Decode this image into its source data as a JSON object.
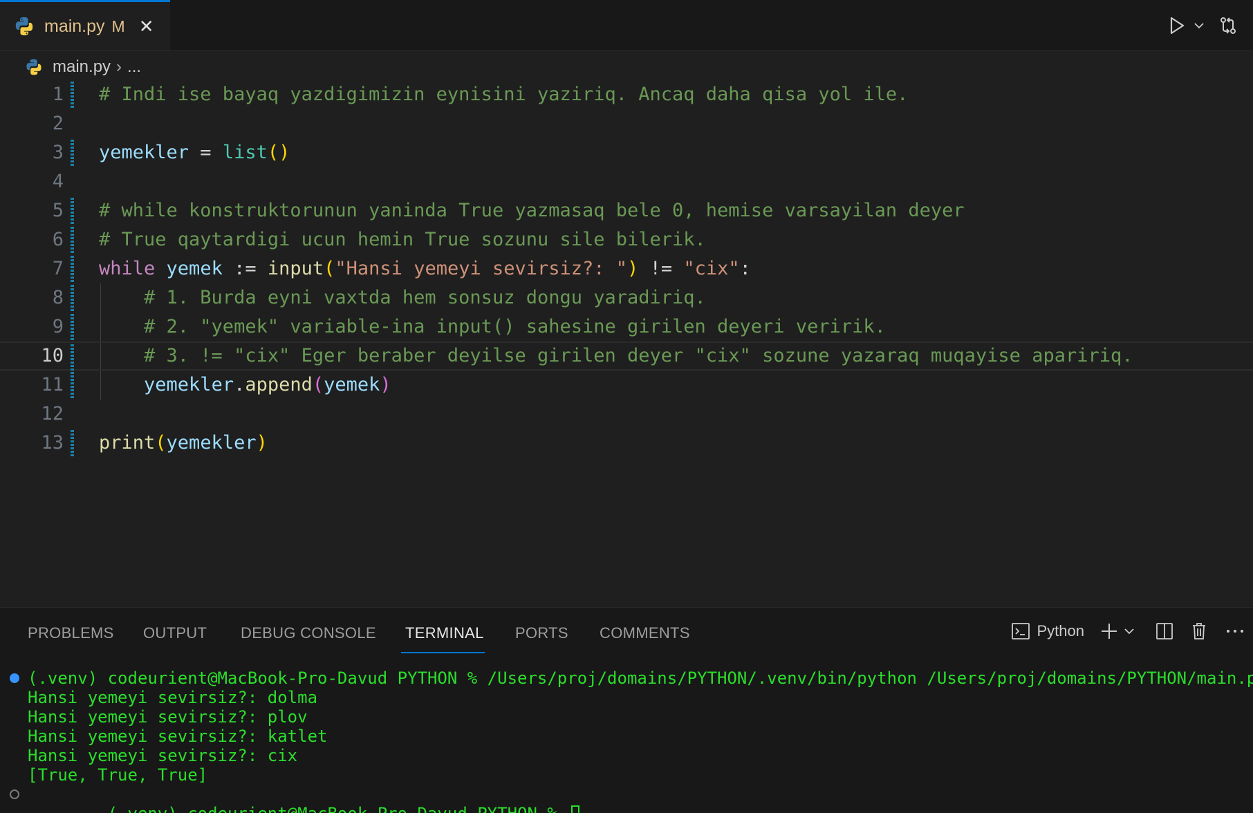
{
  "tab": {
    "file": "main.py",
    "modified": "M",
    "close": "✕",
    "icon": "python-icon"
  },
  "breadcrumb": {
    "file": "main.py",
    "separator": "›",
    "more": "..."
  },
  "editor": {
    "current_line": 10,
    "line_numbers": [
      "1",
      "2",
      "3",
      "4",
      "5",
      "6",
      "7",
      "8",
      "9",
      "10",
      "11",
      "12",
      "13"
    ],
    "lines": [
      [
        {
          "t": "# Indi ise bayaq yazdigimizin eynisini yaziriq. Ancaq daha qisa yol ile.",
          "c": "cmt"
        }
      ],
      [],
      [
        {
          "t": "yemekler",
          "c": "var"
        },
        {
          "t": " = ",
          "c": "op"
        },
        {
          "t": "list",
          "c": "builtin"
        },
        {
          "t": "()",
          "c": "br1"
        }
      ],
      [],
      [
        {
          "t": "# while konstruktorunun yaninda True yazmasaq bele 0, hemise varsayilan deyer",
          "c": "cmt"
        }
      ],
      [
        {
          "t": "# True qaytardigi ucun hemin True sozunu sile bilerik.",
          "c": "cmt"
        }
      ],
      [
        {
          "t": "while",
          "c": "kw"
        },
        {
          "t": " ",
          "c": "op"
        },
        {
          "t": "yemek",
          "c": "var"
        },
        {
          "t": " := ",
          "c": "op"
        },
        {
          "t": "input",
          "c": "fn"
        },
        {
          "t": "(",
          "c": "br1"
        },
        {
          "t": "\"Hansi yemeyi sevirsiz?: \"",
          "c": "str"
        },
        {
          "t": ")",
          "c": "br1"
        },
        {
          "t": " != ",
          "c": "op"
        },
        {
          "t": "\"cix\"",
          "c": "str"
        },
        {
          "t": ":",
          "c": "op"
        }
      ],
      [
        {
          "t": "    # 1. Burda eyni vaxtda hem sonsuz dongu yaradiriq.",
          "c": "cmt"
        }
      ],
      [
        {
          "t": "    # 2. \"yemek\" variable-ina input() sahesine girilen deyeri veririk.",
          "c": "cmt"
        }
      ],
      [
        {
          "t": "    # 3. != \"cix\" Eger beraber deyilse girilen deyer \"cix\" sozune yazaraq muqayise apaririq.",
          "c": "cmt"
        }
      ],
      [
        {
          "t": "    ",
          "c": "op"
        },
        {
          "t": "yemekler",
          "c": "var"
        },
        {
          "t": ".",
          "c": "op"
        },
        {
          "t": "append",
          "c": "fn"
        },
        {
          "t": "(",
          "c": "br2"
        },
        {
          "t": "yemek",
          "c": "var"
        },
        {
          "t": ")",
          "c": "br2"
        }
      ],
      [],
      [
        {
          "t": "print",
          "c": "fn"
        },
        {
          "t": "(",
          "c": "br1"
        },
        {
          "t": "yemekler",
          "c": "var"
        },
        {
          "t": ")",
          "c": "br1"
        }
      ]
    ]
  },
  "panel": {
    "tabs": [
      "PROBLEMS",
      "OUTPUT",
      "DEBUG CONSOLE",
      "TERMINAL",
      "PORTS",
      "COMMENTS"
    ],
    "active_tab": "TERMINAL",
    "terminal_label": "Python",
    "terminal_lines": [
      "(.venv) codeurient@MacBook-Pro-Davud PYTHON % /Users/proj/domains/PYTHON/.venv/bin/python /Users/proj/domains/PYTHON/main.py",
      "Hansi yemeyi sevirsiz?: dolma",
      "Hansi yemeyi sevirsiz?: plov",
      "Hansi yemeyi sevirsiz?: katlet",
      "Hansi yemeyi sevirsiz?: cix",
      "[True, True, True]",
      "(.venv) codeurient@MacBook-Pro-Davud PYTHON % "
    ]
  },
  "colors": {
    "accent": "#0078d4",
    "terminal_text": "#2bde2b",
    "tab_modified": "#e2c08d"
  }
}
